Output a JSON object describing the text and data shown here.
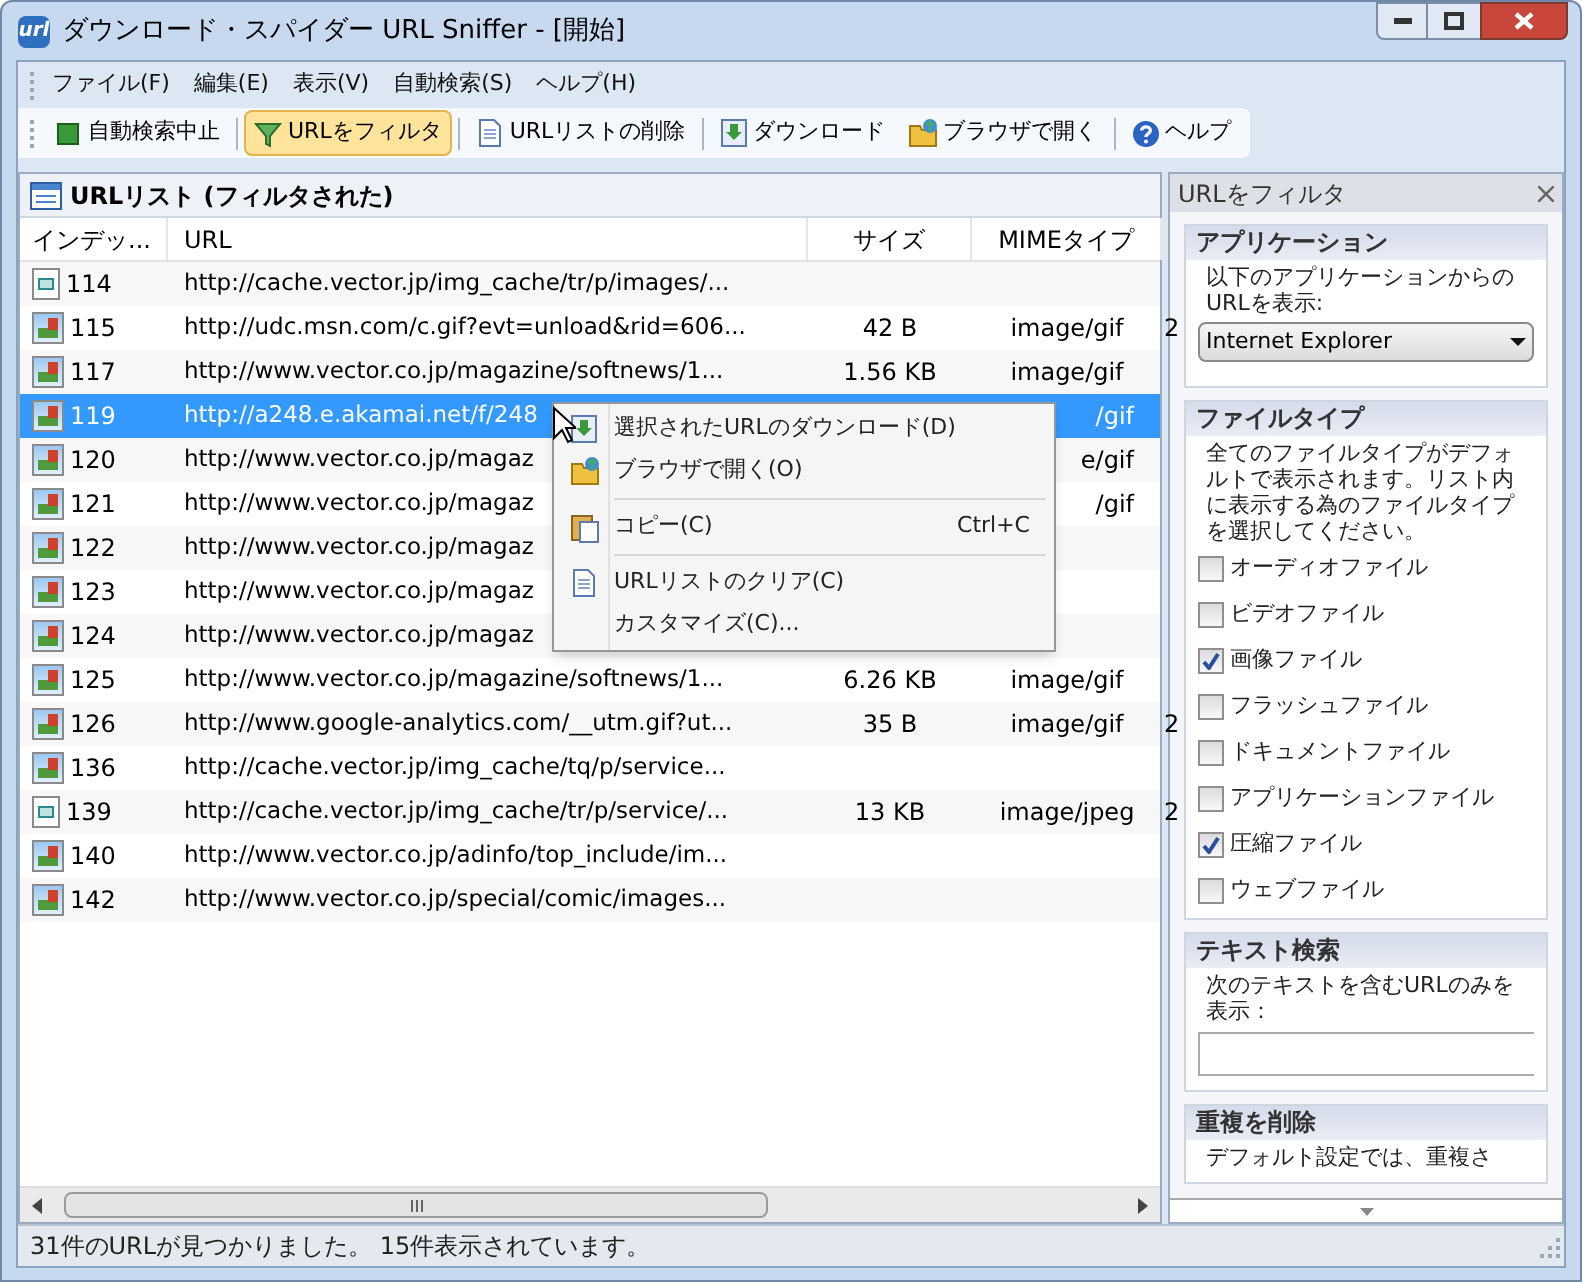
{
  "window": {
    "title": "ダウンロード・スパイダー URL Sniffer - [開始]",
    "app_icon": "url"
  },
  "menu_bar": [
    "ファイル(F)",
    "編集(E)",
    "表示(V)",
    "自動検索(S)",
    "ヘルプ(H)"
  ],
  "toolbar": [
    {
      "label": "自動検索中止",
      "kind": "stop",
      "selected": false
    },
    {
      "label": "URLをフィルタ",
      "kind": "filter",
      "selected": true
    },
    {
      "label": "URLリストの削除",
      "kind": "page",
      "selected": false
    },
    {
      "label": "ダウンロード",
      "kind": "download",
      "selected": false
    },
    {
      "label": "ブラウザで開く",
      "kind": "folder",
      "selected": false
    },
    {
      "label": "ヘルプ",
      "kind": "help",
      "selected": false
    }
  ],
  "list": {
    "title": "URLリスト (フィルタされた)",
    "columns": [
      "インデッ...",
      "URL",
      "サイズ",
      "MIMEタイプ"
    ],
    "rows": [
      {
        "kind": "page",
        "index": "114",
        "url": "http://cache.vector.jp/img_cache/tr/p/images/...",
        "selected": false
      },
      {
        "kind": "image",
        "index": "115",
        "url": "http://udc.msn.com/c.gif?evt=unload&rid=606...",
        "size": "42 B",
        "mime": "image/gif",
        "column_5": "2",
        "selected": false
      },
      {
        "kind": "image",
        "index": "117",
        "url": "http://www.vector.co.jp/magazine/softnews/1...",
        "size": "1.56 KB",
        "mime": "image/gif",
        "selected": false
      },
      {
        "kind": "image",
        "index": "119",
        "url": "http://a248.e.akamai.net/f/248",
        "mime": "/gif",
        "selected": true
      },
      {
        "kind": "image",
        "index": "120",
        "url": "http://www.vector.co.jp/magaz",
        "mime": "e/gif",
        "selected": false
      },
      {
        "kind": "image",
        "index": "121",
        "url": "http://www.vector.co.jp/magaz",
        "mime": "/gif",
        "selected": false
      },
      {
        "kind": "image",
        "index": "122",
        "url": "http://www.vector.co.jp/magaz",
        "selected": false
      },
      {
        "kind": "image",
        "index": "123",
        "url": "http://www.vector.co.jp/magaz",
        "selected": false
      },
      {
        "kind": "image",
        "index": "124",
        "url": "http://www.vector.co.jp/magaz",
        "selected": false
      },
      {
        "kind": "image",
        "index": "125",
        "url": "http://www.vector.co.jp/magazine/softnews/1...",
        "size": "6.26 KB",
        "mime": "image/gif",
        "selected": false
      },
      {
        "kind": "image",
        "index": "126",
        "url": "http://www.google-analytics.com/__utm.gif?ut...",
        "size": "35 B",
        "mime": "image/gif",
        "column_5": "2",
        "selected": false
      },
      {
        "kind": "image",
        "index": "136",
        "url": "http://cache.vector.jp/img_cache/tq/p/service...",
        "selected": false
      },
      {
        "kind": "page",
        "index": "139",
        "url": "http://cache.vector.jp/img_cache/tr/p/service/...",
        "size": "13 KB",
        "mime": "image/jpeg",
        "column_5": "2",
        "selected": false
      },
      {
        "kind": "image",
        "index": "140",
        "url": "http://www.vector.co.jp/adinfo/top_include/im...",
        "selected": false
      },
      {
        "kind": "image",
        "index": "142",
        "url": "http://www.vector.co.jp/special/comic/images...",
        "selected": false
      }
    ]
  },
  "context_menu": [
    {
      "kind": "item",
      "label": "選択されたURLのダウンロード(D)"
    },
    {
      "kind": "item",
      "label": "ブラウザで開く(O)"
    },
    {
      "kind": "separator"
    },
    {
      "kind": "item",
      "label": "コピー(C)",
      "shortcut": "Ctrl+C"
    },
    {
      "kind": "separator"
    },
    {
      "kind": "item",
      "label": "URLリストのクリア(C)"
    },
    {
      "kind": "item",
      "label": "カスタマイズ(C)..."
    }
  ],
  "filter_panel": {
    "title": "URLをフィルタ",
    "application": {
      "heading": "アプリケーション",
      "description": "以下のアプリケーションからのURLを表示:",
      "value": "Internet Explorer"
    },
    "file_type": {
      "heading": "ファイルタイプ",
      "description": "全てのファイルタイプがデフォルトで表示されます。リスト内に表示する為のファイルタイプを選択してください。",
      "options": [
        {
          "label": "オーディオファイル",
          "checked": false
        },
        {
          "label": "ビデオファイル",
          "checked": false
        },
        {
          "label": "画像ファイル",
          "checked": true
        },
        {
          "label": "フラッシュファイル",
          "checked": false
        },
        {
          "label": "ドキュメントファイル",
          "checked": false
        },
        {
          "label": "アプリケーションファイル",
          "checked": false
        },
        {
          "label": "圧縮ファイル",
          "checked": true
        },
        {
          "label": "ウェブファイル",
          "checked": false
        }
      ]
    },
    "text_search": {
      "heading": "テキスト検索",
      "description": "次のテキストを含むURLのみを表示："
    },
    "remove_duplicates": {
      "heading": "重複を削除",
      "description": "デフォルト設定では、重複さ"
    }
  },
  "status_bar": "31件のURLが見つかりました。 15件表示されています。"
}
